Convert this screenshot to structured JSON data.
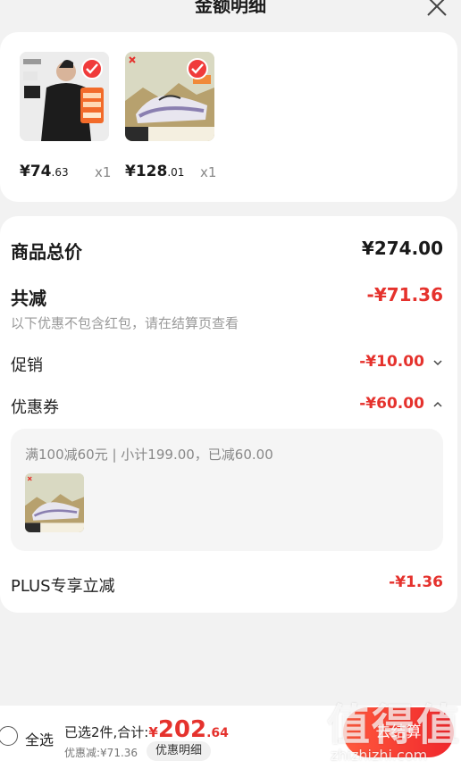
{
  "header": {
    "title": "金额明细",
    "close_icon": "close-icon"
  },
  "products": [
    {
      "price_int": "¥74",
      "price_dec": ".63",
      "qty": "x1",
      "image": "black-jacket-model",
      "selected": true
    },
    {
      "price_int": "¥128",
      "price_dec": ".01",
      "qty": "x1",
      "image": "white-sneaker",
      "selected": true
    }
  ],
  "details": {
    "goods_total_label": "商品总价",
    "goods_total_value": "¥274.00",
    "total_discount_label": "共减",
    "total_discount_value": "-¥71.36",
    "note": "以下优惠不包含红包，请在结算页查看",
    "promo_label": "促销",
    "promo_value": "-¥10.00",
    "coupon_label": "优惠券",
    "coupon_value": "-¥60.00",
    "coupon_detail": "满100减60元 | 小计199.00，已减60.00",
    "plus_label": "PLUS专享立减",
    "plus_value": "-¥1.36"
  },
  "footer": {
    "select_all": "全选",
    "selected_summary": "已选2件,合计:",
    "total_yen": "¥",
    "total_int": "202",
    "total_dec": ".64",
    "discount_summary": "优惠减:¥71.36",
    "detail_button": "优惠明细",
    "checkout_button": "去结算"
  },
  "watermark": {
    "main": "值得值",
    "url": "zhizhizhi.com"
  },
  "colors": {
    "accent": "#e5322d",
    "checkout_start": "#ff5a3d",
    "checkout_end": "#f0262c"
  }
}
